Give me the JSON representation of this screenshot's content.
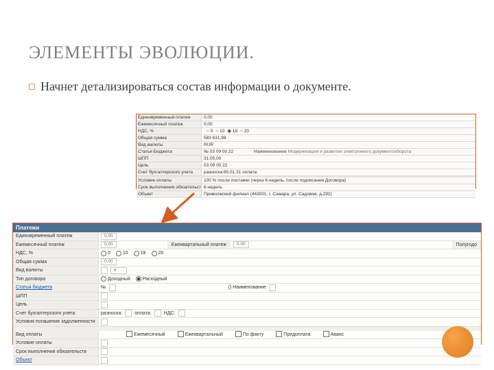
{
  "title": "ЭЛЕМЕНТЫ ЭВОЛЮЦИИ.",
  "bullet": "Начнет детализироваться состав информации о документе.",
  "arrow_color": "#d25e23",
  "top_box": {
    "rows": [
      {
        "label": "Единовременный платеж",
        "value": "0,00"
      },
      {
        "label": "Ежемесячный платеж",
        "value": "0,00"
      },
      {
        "label": "НДС, %",
        "value": "",
        "radios": [
          "0",
          "10",
          "18",
          "20"
        ],
        "selected": "18"
      },
      {
        "label": "Общая сумма",
        "value": "583 631,98"
      },
      {
        "label": "Вид валюты",
        "value": "RUR"
      },
      {
        "label": "Статья Бюджета",
        "value": "№ 03 09 00 22",
        "extra_label": "Наименование",
        "extra_value": "Модернизация и развитие электронного документооборота"
      },
      {
        "label": "ШПП",
        "value": "31.05.00"
      },
      {
        "label": "Цель",
        "value": "03 09 00 22"
      },
      {
        "label": "Счет бухгалтерского учета",
        "value": "разноска:60.01.21  оплата:"
      },
      {
        "spacer": true
      },
      {
        "label": "Условие оплаты",
        "value": "100 % после поставки (через 6 недель, после подписания Договора)"
      },
      {
        "label": "Срок выполнения обязательств",
        "value": "6 недель"
      },
      {
        "label": "Объект",
        "value": "Приволжский филиал (443001, г. Самара, ул. Садовая, д.292)"
      }
    ]
  },
  "bottom_box": {
    "header": "Платежи",
    "rows": {
      "r1": {
        "label": "Единовременный платеж",
        "field": "0,00"
      },
      "r2": {
        "label": "Ежемесячный платеж",
        "field": "0,00",
        "mid_label": "Ежеквартальный платеж",
        "mid_field": "0,00",
        "right_label": "Полугодо"
      },
      "r3": {
        "label": "НДС, %",
        "radios": [
          "0",
          "10",
          "18",
          "20"
        ]
      },
      "r4": {
        "label": "Общая сумма",
        "field": "0,00"
      },
      "r5": {
        "label": "Вид валюты"
      },
      "r6": {
        "label": "Тип договора",
        "radios": [
          "Доходный",
          "Расходный"
        ],
        "selected": "Расходный"
      },
      "r7": {
        "label": "Статья бюджета",
        "prefix": "№",
        "mid_label": "()  Наименование"
      },
      "r8": {
        "label": "ШПП"
      },
      "r9": {
        "label": "Цель"
      },
      "r10": {
        "label": "Счет бухгалтерского учета",
        "parts": [
          "разноска:",
          "оплата:",
          "НДС:"
        ]
      },
      "r11": {
        "label": "Условия погашения задолженности"
      },
      "r12": {
        "label": "Вид оплаты",
        "checks": [
          "Ежемесячный",
          "Ежеквартальный",
          "По факту",
          "Предоплата",
          "Аванс"
        ]
      },
      "r13": {
        "label": "Условие оплаты"
      },
      "r14": {
        "label": "Срок выполнения обязательств"
      },
      "r15": {
        "label": "Объект"
      }
    }
  }
}
